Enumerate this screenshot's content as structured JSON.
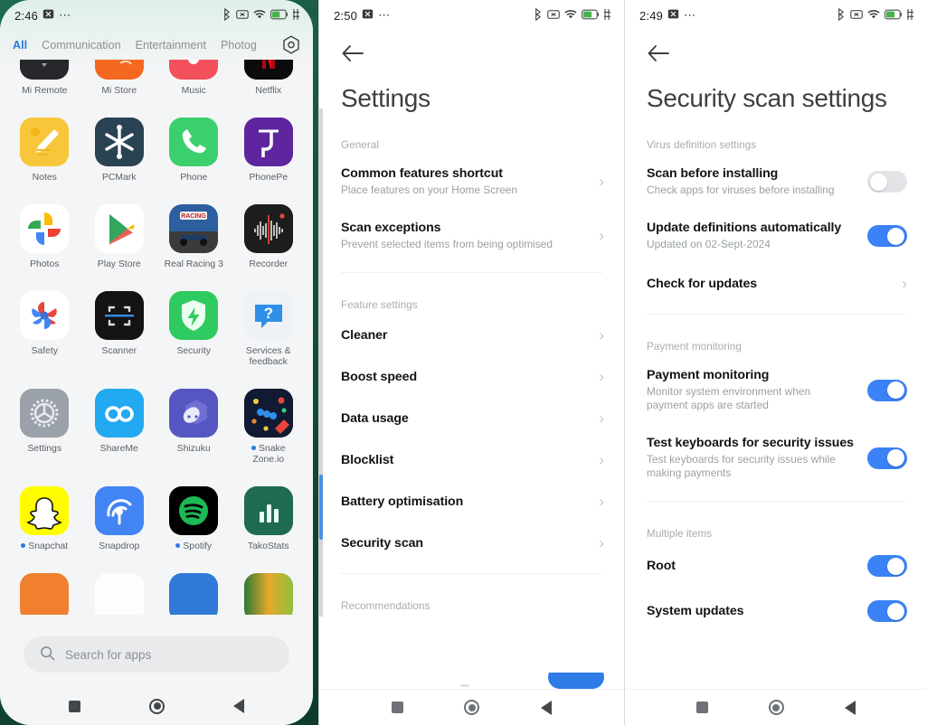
{
  "phone1": {
    "status": {
      "time": "2:46",
      "overflow_dots": "⋯",
      "icons": [
        "cast-icon",
        "no-sim-icon",
        "bluetooth-icon",
        "wifi-icon",
        "battery-icon",
        "charging-icon"
      ]
    },
    "tabs": [
      {
        "label": "All",
        "active": true
      },
      {
        "label": "Communication",
        "active": false
      },
      {
        "label": "Entertainment",
        "active": false
      },
      {
        "label": "Photog",
        "active": false
      }
    ],
    "tabs_settings_icon": "gear-hex-icon",
    "apps": [
      {
        "label": "Mi Remote",
        "dot": false
      },
      {
        "label": "Mi Store",
        "dot": false
      },
      {
        "label": "Music",
        "dot": false
      },
      {
        "label": "Netflix",
        "dot": false
      },
      {
        "label": "Notes",
        "dot": false
      },
      {
        "label": "PCMark",
        "dot": false
      },
      {
        "label": "Phone",
        "dot": false
      },
      {
        "label": "PhonePe",
        "dot": false
      },
      {
        "label": "Photos",
        "dot": false
      },
      {
        "label": "Play Store",
        "dot": false
      },
      {
        "label": "Real Racing 3",
        "dot": false
      },
      {
        "label": "Recorder",
        "dot": false
      },
      {
        "label": "Safety",
        "dot": false
      },
      {
        "label": "Scanner",
        "dot": false
      },
      {
        "label": "Security",
        "dot": false
      },
      {
        "label": "Services & feedback",
        "dot": false
      },
      {
        "label": "Settings",
        "dot": false
      },
      {
        "label": "ShareMe",
        "dot": false
      },
      {
        "label": "Shizuku",
        "dot": false
      },
      {
        "label": "Snake Zone.io",
        "dot": true
      },
      {
        "label": "Snapchat",
        "dot": true
      },
      {
        "label": "Snapdrop",
        "dot": false
      },
      {
        "label": "Spotify",
        "dot": true
      },
      {
        "label": "TakoStats",
        "dot": false
      }
    ],
    "search": {
      "placeholder": "Search for apps",
      "icon": "search-icon"
    },
    "nav": {
      "recents": "recents-square-icon",
      "home": "home-circle-icon",
      "back": "back-triangle-icon"
    }
  },
  "phone2": {
    "status": {
      "time": "2:50",
      "overflow_dots": "⋯"
    },
    "back_icon": "back-arrow-icon",
    "title": "Settings",
    "sections": [
      {
        "label": "General",
        "rows": [
          {
            "title": "Common features shortcut",
            "sub": "Place features on your Home Screen",
            "control": "chevron"
          },
          {
            "title": "Scan exceptions",
            "sub": "Prevent selected items from being optimised",
            "control": "chevron"
          }
        ]
      },
      {
        "label": "Feature settings",
        "rows": [
          {
            "title": "Cleaner",
            "sub": "",
            "control": "chevron"
          },
          {
            "title": "Boost speed",
            "sub": "",
            "control": "chevron"
          },
          {
            "title": "Data usage",
            "sub": "",
            "control": "chevron"
          },
          {
            "title": "Blocklist",
            "sub": "",
            "control": "chevron"
          },
          {
            "title": "Battery optimisation",
            "sub": "",
            "control": "chevron"
          },
          {
            "title": "Security scan",
            "sub": "",
            "control": "chevron"
          }
        ]
      },
      {
        "label": "Recommendations",
        "rows": []
      }
    ],
    "nav": {
      "recents": "recents-square-icon",
      "home": "home-circle-icon",
      "back": "back-triangle-icon"
    }
  },
  "phone3": {
    "status": {
      "time": "2:49",
      "overflow_dots": "⋯"
    },
    "back_icon": "back-arrow-icon",
    "title": "Security scan settings",
    "sections": [
      {
        "label": "Virus definition settings",
        "rows": [
          {
            "title": "Scan before installing",
            "sub": "Check apps for viruses before installing",
            "control": "toggle",
            "on": false
          },
          {
            "title": "Update definitions automatically",
            "sub": "Updated on 02-Sept-2024",
            "control": "toggle",
            "on": true
          },
          {
            "title": "Check for updates",
            "sub": "",
            "control": "chevron"
          }
        ]
      },
      {
        "label": "Payment monitoring",
        "rows": [
          {
            "title": "Payment monitoring",
            "sub": "Monitor system environment when payment apps are started",
            "control": "toggle",
            "on": true
          },
          {
            "title": "Test keyboards for security issues",
            "sub": "Test keyboards for security issues while making payments",
            "control": "toggle",
            "on": true
          }
        ]
      },
      {
        "label": "Multiple items",
        "rows": [
          {
            "title": "Root",
            "sub": "",
            "control": "toggle",
            "on": true
          },
          {
            "title": "System updates",
            "sub": "",
            "control": "toggle",
            "on": true
          }
        ]
      }
    ],
    "nav": {
      "recents": "recents-square-icon",
      "home": "home-circle-icon",
      "back": "back-triangle-icon"
    }
  },
  "colors": {
    "accent_blue": "#3b82f6",
    "tab_active": "#2979e6",
    "toggle_off": "#e2e4e7",
    "scrollbar": "#4a90e2"
  }
}
